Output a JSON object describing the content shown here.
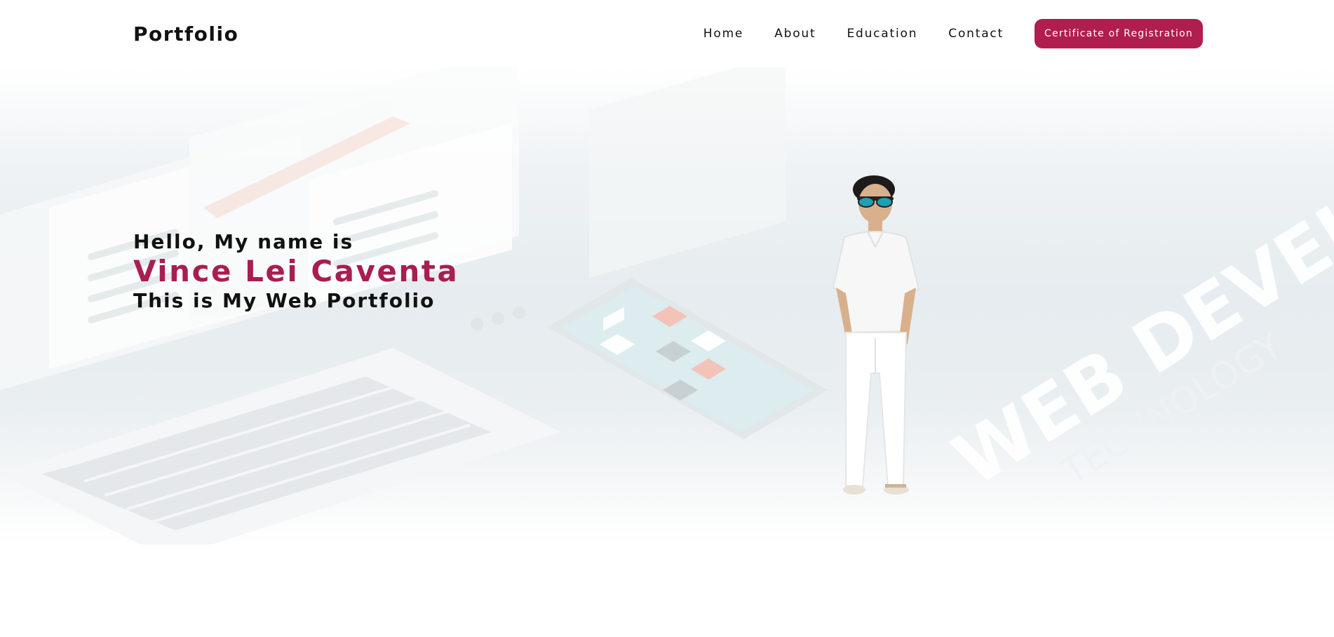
{
  "header": {
    "brand": "Portfolio",
    "nav": [
      {
        "label": "Home"
      },
      {
        "label": "About"
      },
      {
        "label": "Education"
      },
      {
        "label": "Contact"
      }
    ],
    "cta_label": "Certificate of Registration"
  },
  "hero": {
    "greeting": "Hello, My name is",
    "name": "Vince Lei Caventa",
    "tagline": "This is My Web Portfolio",
    "background_text": "WEB DEVELOPMENT",
    "background_subtext": "TECHNOLOGY"
  },
  "colors": {
    "accent": "#b01d4f",
    "name_color": "#a81e50",
    "text": "#111111"
  }
}
